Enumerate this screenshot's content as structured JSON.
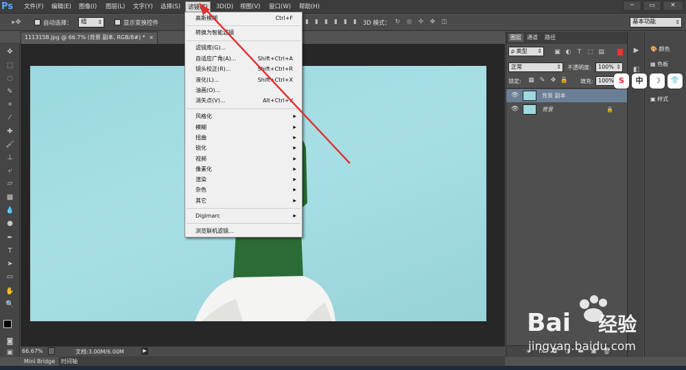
{
  "menubar": {
    "logo": "Ps",
    "items": [
      "文件(F)",
      "编辑(E)",
      "图像(I)",
      "图层(L)",
      "文字(Y)",
      "选择(S)",
      "滤镜(T)",
      "3D(D)",
      "视图(V)",
      "窗口(W)",
      "帮助(H)"
    ],
    "active_item": "滤镜(T)"
  },
  "window_controls": {
    "minimize": "─",
    "restore": "▭",
    "close": "✕"
  },
  "options_bar": {
    "auto_select_label": "自动选择：",
    "auto_select_value": "组",
    "show_transform_label": "显示变换控件",
    "mode_3d_label": "3D 模式：",
    "workspace": "基本功能"
  },
  "document": {
    "tab_title": "1113158.jpg @ 66.7% (背景 副本, RGB/8#) *",
    "tab_close": "×"
  },
  "status": {
    "zoom": "66.67%",
    "doc_info": "文档:3.00M/6.00M"
  },
  "bottom_tabs": [
    "Mini Bridge",
    "时间轴"
  ],
  "filter_menu": {
    "items": [
      {
        "label": "高斯模糊",
        "shortcut": "Ctrl+F"
      },
      {
        "label": "转换为智能滤镜",
        "shortcut": ""
      },
      {
        "label": "滤镜库(G)...",
        "shortcut": ""
      },
      {
        "label": "自适应广角(A)...",
        "shortcut": "Shift+Ctrl+A"
      },
      {
        "label": "镜头校正(R)...",
        "shortcut": "Shift+Ctrl+R"
      },
      {
        "label": "液化(L)...",
        "shortcut": "Shift+Ctrl+X"
      },
      {
        "label": "油画(O)...",
        "shortcut": ""
      },
      {
        "label": "消失点(V)...",
        "shortcut": "Alt+Ctrl+V"
      },
      {
        "label": "风格化",
        "shortcut": ""
      },
      {
        "label": "模糊",
        "shortcut": ""
      },
      {
        "label": "扭曲",
        "shortcut": ""
      },
      {
        "label": "锐化",
        "shortcut": ""
      },
      {
        "label": "视频",
        "shortcut": ""
      },
      {
        "label": "像素化",
        "shortcut": ""
      },
      {
        "label": "渲染",
        "shortcut": ""
      },
      {
        "label": "杂色",
        "shortcut": ""
      },
      {
        "label": "其它",
        "shortcut": ""
      },
      {
        "label": "Digimarc",
        "shortcut": ""
      },
      {
        "label": "浏览联机滤镜...",
        "shortcut": ""
      }
    ],
    "submenu_arrow": "▶"
  },
  "layers_panel": {
    "tabs": [
      "图层",
      "通道",
      "路径"
    ],
    "filter_kind": "ρ 类型",
    "blend_mode": "正常",
    "opacity_label": "不透明度:",
    "opacity_value": "100%",
    "lock_label": "锁定:",
    "fill_label": "填充:",
    "fill_value": "100%",
    "layers": [
      {
        "name": "背景 副本",
        "selected": true,
        "locked": false
      },
      {
        "name": "背景",
        "selected": false,
        "locked": true
      }
    ],
    "footer_icons": [
      "∞",
      "fx",
      "◘",
      "◑",
      "▬",
      "▣",
      "🗑"
    ]
  },
  "right_panels": {
    "items": [
      "颜色",
      "色板",
      "样式"
    ]
  },
  "ime_toolbar": [
    "S",
    "中",
    "☽",
    "👕"
  ],
  "watermark": {
    "brand": "Bai",
    "brand2": "经验",
    "url": "jingyan.baidu.com"
  },
  "colors": {
    "canvas_bg": "#a0dbe1",
    "menu_bg": "#f0f0f0",
    "accent": "#e03030"
  }
}
